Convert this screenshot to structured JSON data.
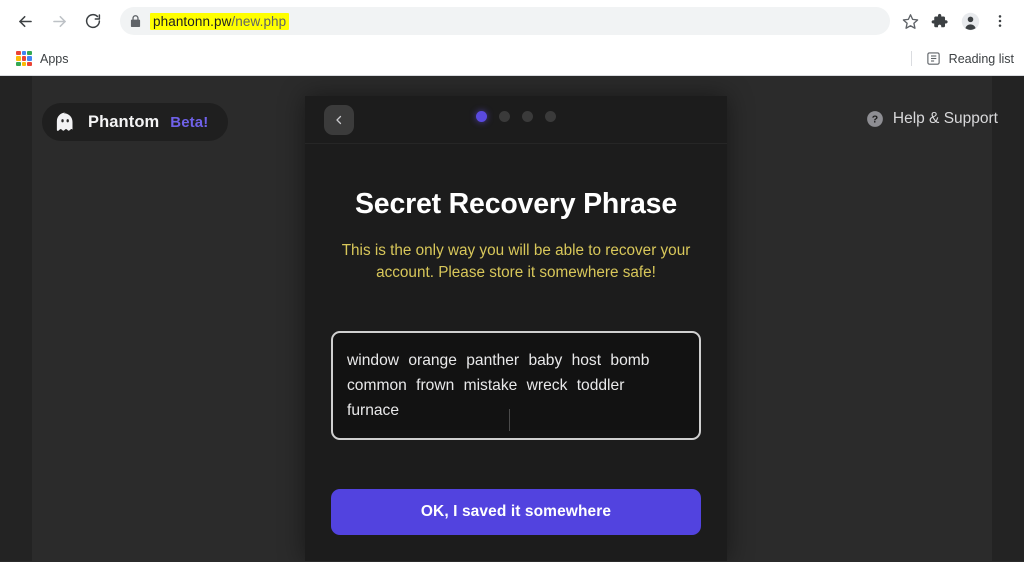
{
  "browser": {
    "back_icon": "arrow-left-icon",
    "forward_icon": "arrow-right-icon",
    "reload_icon": "reload-icon",
    "lock_icon": "lock-icon",
    "url_host": "phantonn.pw",
    "url_path": "/new.php",
    "url_full": "phantonn.pw/new.php",
    "url_highlight_color": "#ffff00",
    "bookmark_star_icon": "star-icon",
    "extensions_icon": "puzzle-piece-icon",
    "profile_icon": "profile-avatar-icon",
    "menu_icon": "three-dot-menu-icon",
    "apps_label": "Apps",
    "apps_icon": "apps-grid-icon",
    "reading_list_label": "Reading list",
    "reading_list_icon": "reading-list-icon"
  },
  "page": {
    "brand": {
      "logo_icon": "phantom-ghost-icon",
      "name": "Phantom",
      "beta_label": "Beta!",
      "beta_color": "#6f61e8"
    },
    "help": {
      "icon": "question-mark-circle-icon",
      "label": "Help & Support"
    },
    "card": {
      "back_icon": "chevron-left-icon",
      "steps": {
        "total": 4,
        "active_index": 0,
        "active_color": "#5a4ae0"
      },
      "title": "Secret Recovery Phrase",
      "warning": "This is the only way you will be able to recover your account. Please store it somewhere safe!",
      "warning_color": "#d8c75a",
      "seed_phrase": "window orange panther baby host bomb common frown mistake wreck toddler furnace",
      "seed_words": [
        "window",
        "orange",
        "panther",
        "baby",
        "host",
        "bomb",
        "common",
        "frown",
        "mistake",
        "wreck",
        "toddler",
        "furnace"
      ],
      "primary_button": "OK, I saved it somewhere",
      "primary_button_color": "#5243df"
    }
  }
}
